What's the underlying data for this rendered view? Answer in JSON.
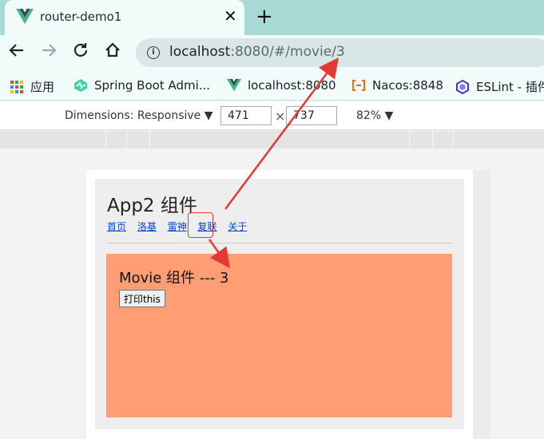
{
  "browser": {
    "tab_title": "router-demo1",
    "close_glyph": "✕",
    "new_tab_glyph": "+",
    "url_host": "localhost",
    "url_rest": ":8080/#/movie/3"
  },
  "bookmarks": [
    {
      "icon": "apps-icon",
      "label": "应用"
    },
    {
      "icon": "spring-boot-admin-icon",
      "label": "Spring Boot Admi..."
    },
    {
      "icon": "vue-icon",
      "label": "localhost:8080"
    },
    {
      "icon": "nacos-icon",
      "label": "Nacos:8848"
    },
    {
      "icon": "eslint-icon",
      "label": "ESLint - 插件"
    }
  ],
  "devtools": {
    "dimensions_label": "Dimensions: Responsive ▼",
    "width": "471",
    "height": "737",
    "zoom_label": "82% ▼",
    "times_glyph": "×"
  },
  "app": {
    "title": "App2 组件",
    "nav": [
      "首页",
      "洛基",
      "雷神",
      "复联",
      "关于"
    ],
    "movie_title": "Movie 组件 --- 3",
    "print_button": "打印this"
  },
  "colors": {
    "movie_bg": "#ff9d74",
    "annotation": "#e53935",
    "tab_strip": "#a9d9d4"
  }
}
